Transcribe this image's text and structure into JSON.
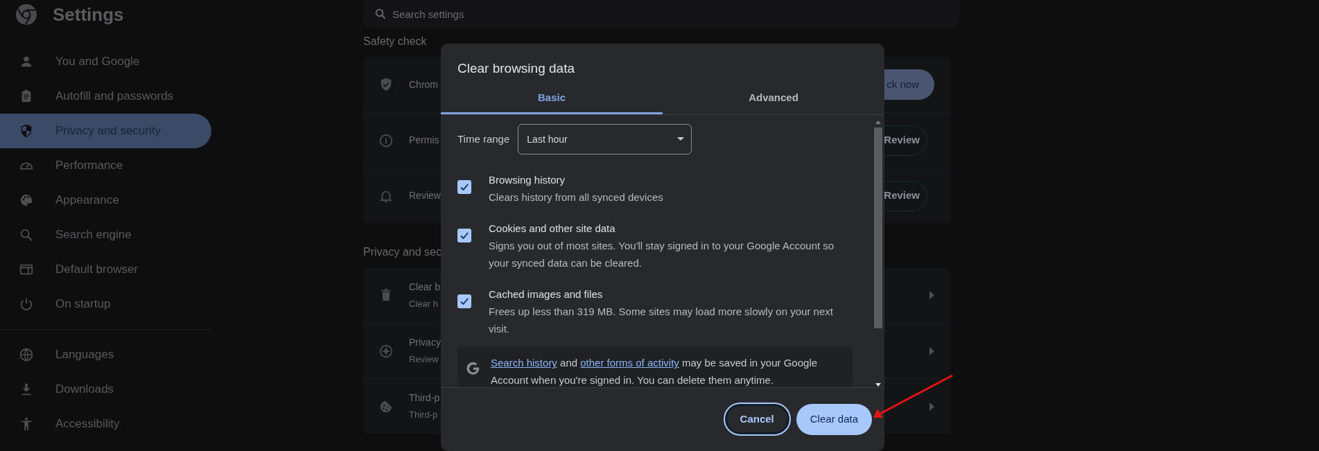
{
  "sidebar": {
    "title": "Settings",
    "sections": [
      {
        "items": [
          {
            "label": "You and Google",
            "selected": false
          },
          {
            "label": "Autofill and passwords",
            "selected": false
          },
          {
            "label": "Privacy and security",
            "selected": true
          },
          {
            "label": "Performance",
            "selected": false
          },
          {
            "label": "Appearance",
            "selected": false
          },
          {
            "label": "Search engine",
            "selected": false
          },
          {
            "label": "Default browser",
            "selected": false
          },
          {
            "label": "On startup",
            "selected": false
          }
        ]
      },
      {
        "items": [
          {
            "label": "Languages",
            "selected": false
          },
          {
            "label": "Downloads",
            "selected": false
          },
          {
            "label": "Accessibility",
            "selected": false
          }
        ]
      }
    ]
  },
  "search": {
    "placeholder": "Search settings"
  },
  "safety_check": {
    "heading": "Safety check",
    "rows": [
      {
        "title": "Chrom",
        "button": {
          "label": "ck now",
          "kind": "filled"
        }
      },
      {
        "title": "Permis",
        "button": {
          "label": "Review",
          "kind": "outlined"
        }
      },
      {
        "title": "Review",
        "button": {
          "label": "Review",
          "kind": "outlined"
        }
      }
    ]
  },
  "privacy_section": {
    "heading": "Privacy and sec",
    "rows": [
      {
        "title": "Clear b",
        "subtitle": "Clear h"
      },
      {
        "title": "Privacy",
        "subtitle": "Review"
      },
      {
        "title": "Third-p",
        "subtitle": "Third-p"
      }
    ]
  },
  "dialog": {
    "title": "Clear browsing data",
    "tabs": [
      {
        "label": "Basic",
        "selected": true
      },
      {
        "label": "Advanced",
        "selected": false
      }
    ],
    "time_range": {
      "label": "Time range",
      "value": "Last hour"
    },
    "options": [
      {
        "title": "Browsing history",
        "description": "Clears history from all synced devices",
        "checked": true
      },
      {
        "title": "Cookies and other site data",
        "description": "Signs you out of most sites. You'll stay signed in to your Google Account so your synced data can be cleared.",
        "checked": true
      },
      {
        "title": "Cached images and files",
        "description": "Frees up less than 319 MB. Some sites may load more slowly on your next visit.",
        "checked": true
      }
    ],
    "notice": [
      {
        "text": "Search history",
        "link": true
      },
      {
        "text": " and ",
        "link": false
      },
      {
        "text": "other forms of activity",
        "link": true
      },
      {
        "text": " may be saved in your Google Account when you're signed in. You can delete them anytime.",
        "link": false
      }
    ],
    "buttons": [
      {
        "label": "Cancel",
        "kind": "outlined"
      },
      {
        "label": "Clear data",
        "kind": "filled"
      }
    ]
  }
}
